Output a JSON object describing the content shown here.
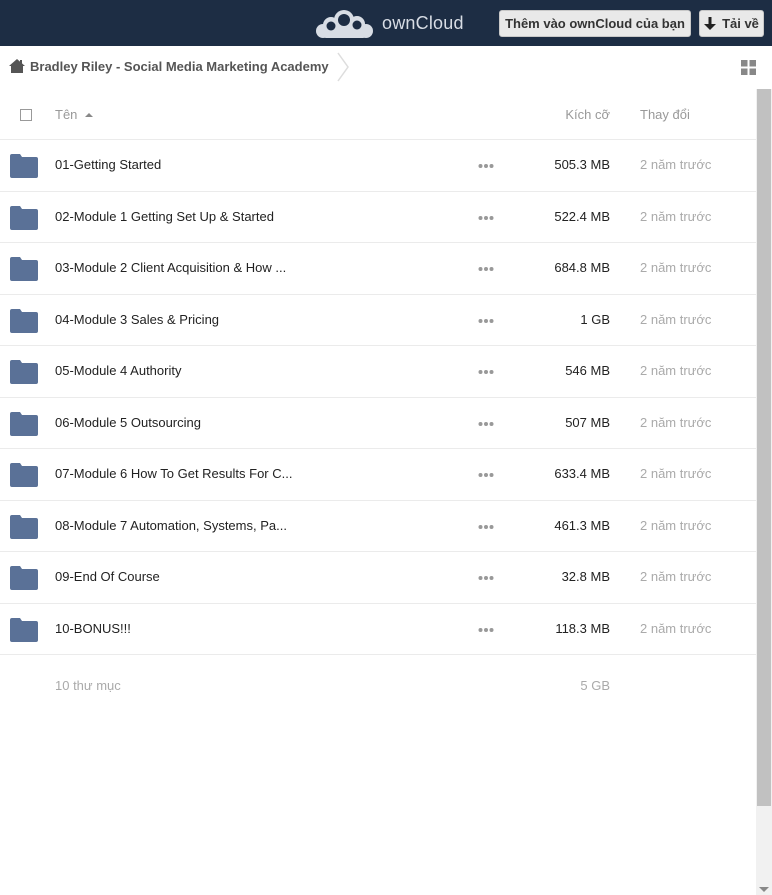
{
  "header": {
    "brand": "ownCloud",
    "add_button_label": "Thêm vào ownCloud của bạn",
    "download_button_label": "Tải về"
  },
  "breadcrumb": {
    "home_icon": "home-icon",
    "current": "Bradley Riley - Social Media Marketing Academy"
  },
  "table": {
    "columns": {
      "name": "Tên",
      "size": "Kích cỡ",
      "modified": "Thay đổi"
    },
    "rows": [
      {
        "name": "01-Getting Started",
        "size": "505.3 MB",
        "modified": "2 năm trước"
      },
      {
        "name": "02-Module 1 Getting Set Up & Started",
        "size": "522.4 MB",
        "modified": "2 năm trước"
      },
      {
        "name": "03-Module 2 Client Acquisition & How ...",
        "size": "684.8 MB",
        "modified": "2 năm trước"
      },
      {
        "name": "04-Module 3 Sales & Pricing",
        "size": "1 GB",
        "modified": "2 năm trước"
      },
      {
        "name": "05-Module 4 Authority",
        "size": "546 MB",
        "modified": "2 năm trước"
      },
      {
        "name": "06-Module 5 Outsourcing",
        "size": "507 MB",
        "modified": "2 năm trước"
      },
      {
        "name": "07-Module 6 How To Get Results For C...",
        "size": "633.4 MB",
        "modified": "2 năm trước"
      },
      {
        "name": "08-Module 7 Automation, Systems, Pa...",
        "size": "461.3 MB",
        "modified": "2 năm trước"
      },
      {
        "name": "09-End Of Course",
        "size": "32.8 MB",
        "modified": "2 năm trước"
      },
      {
        "name": "10-BONUS!!!",
        "size": "118.3 MB",
        "modified": "2 năm trước"
      }
    ],
    "summary": {
      "count": "10 thư mục",
      "total_size": "5 GB"
    }
  },
  "colors": {
    "header_bg": "#1d2d44",
    "folder": "#5a7197",
    "muted_text": "#aaaaaa"
  }
}
